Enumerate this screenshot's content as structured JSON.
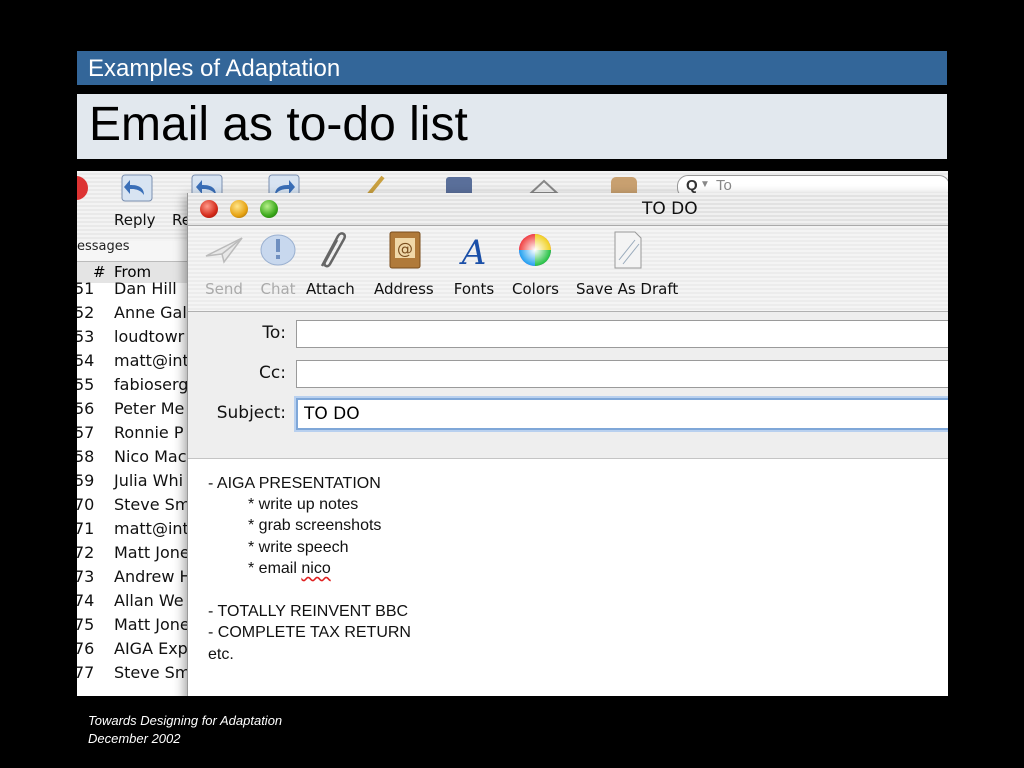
{
  "slide": {
    "banner": "Examples of Adaptation",
    "title": "Email as to-do list",
    "footer_line1": "Towards Designing for Adaptation",
    "footer_line2": "December 2002"
  },
  "bg_window": {
    "toolbar_labels": [
      "e",
      "Reply",
      "Re"
    ],
    "search_text": "To",
    "messages_label": "essages",
    "col_num": "#",
    "col_from": "From",
    "rows": [
      {
        "num": "51",
        "from": "Dan Hill"
      },
      {
        "num": "52",
        "from": "Anne Gal"
      },
      {
        "num": "53",
        "from": "loudtowr"
      },
      {
        "num": "54",
        "from": "matt@int"
      },
      {
        "num": "55",
        "from": "fabioserg"
      },
      {
        "num": "56",
        "from": "Peter Me"
      },
      {
        "num": "57",
        "from": "Ronnie P"
      },
      {
        "num": "58",
        "from": "Nico Mac"
      },
      {
        "num": "59",
        "from": "Julia Whi"
      },
      {
        "num": "70",
        "from": "Steve Sm"
      },
      {
        "num": "71",
        "from": "matt@int"
      },
      {
        "num": "72",
        "from": "Matt Jone"
      },
      {
        "num": "73",
        "from": "Andrew H"
      },
      {
        "num": "74",
        "from": "Allan We"
      },
      {
        "num": "75",
        "from": "Matt Jone"
      },
      {
        "num": "76",
        "from": "AIGA Exp"
      },
      {
        "num": "77",
        "from": "Steve Sm"
      }
    ]
  },
  "compose": {
    "window_title": "TO DO",
    "toolbar": {
      "send": "Send",
      "chat": "Chat",
      "attach": "Attach",
      "address": "Address",
      "fonts": "Fonts",
      "colors": "Colors",
      "save_draft": "Save As Draft"
    },
    "fields": {
      "to_label": "To:",
      "to_value": "",
      "cc_label": "Cc:",
      "cc_value": "",
      "subject_label": "Subject:",
      "subject_value": "TO DO"
    },
    "body": {
      "line1": "- AIGA PRESENTATION",
      "line2": "* write up notes",
      "line3": "* grab screenshots",
      "line4": "* write speech",
      "line5_prefix": "* email ",
      "line5_word": "nico",
      "line6": "- TOTALLY REINVENT BBC",
      "line7": "- COMPLETE TAX RETURN",
      "line8": "etc."
    }
  },
  "colors": {
    "banner": "#336699",
    "title_box": "#e2e8ee",
    "slide_bg": "#000000"
  }
}
